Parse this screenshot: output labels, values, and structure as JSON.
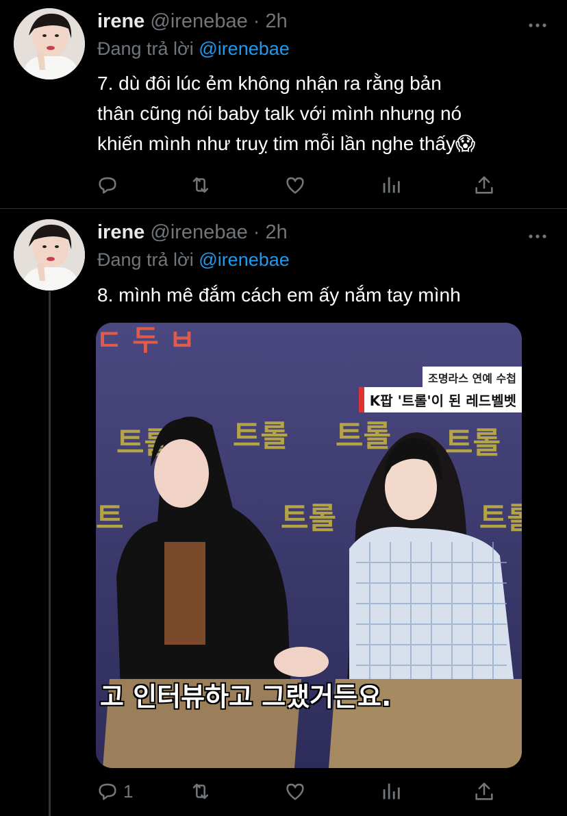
{
  "tweets": [
    {
      "name": "irene",
      "handle": "@irenebae",
      "separator": "·",
      "time": "2h",
      "reply_prefix": "Đang trả lời",
      "reply_mention": "@irenebae",
      "text_lines": [
        "7. dù đôi lúc ẻm không nhận ra rằng bản",
        "thân cũng nói baby talk với mình nhưng nó",
        "khiến mình như truỵ tim mỗi lần nghe thấy😱"
      ],
      "reply_count": "",
      "icons": [
        "reply-icon",
        "retweet-icon",
        "like-icon",
        "analytics-icon",
        "share-icon"
      ]
    },
    {
      "name": "irene",
      "handle": "@irenebae",
      "separator": "·",
      "time": "2h",
      "reply_prefix": "Đang trả lời",
      "reply_mention": "@irenebae",
      "text": "8. mình mê đắm cách em ấy nắm tay mình",
      "reply_count": "1",
      "icons": [
        "reply-icon",
        "retweet-icon",
        "like-icon",
        "analytics-icon",
        "share-icon"
      ],
      "media": {
        "caption": "고 인터뷰하고 그랬거든요.",
        "news_top": "조명라스 연예 수첩",
        "news_band": "K팝 '트롤'이 된 레드벨벳",
        "backdrop_logo": "트롤"
      }
    }
  ],
  "colors": {
    "background": "#000000",
    "text": "#ffffff",
    "muted": "#71767b",
    "link": "#1d9bf0",
    "divider": "#2f3336"
  }
}
